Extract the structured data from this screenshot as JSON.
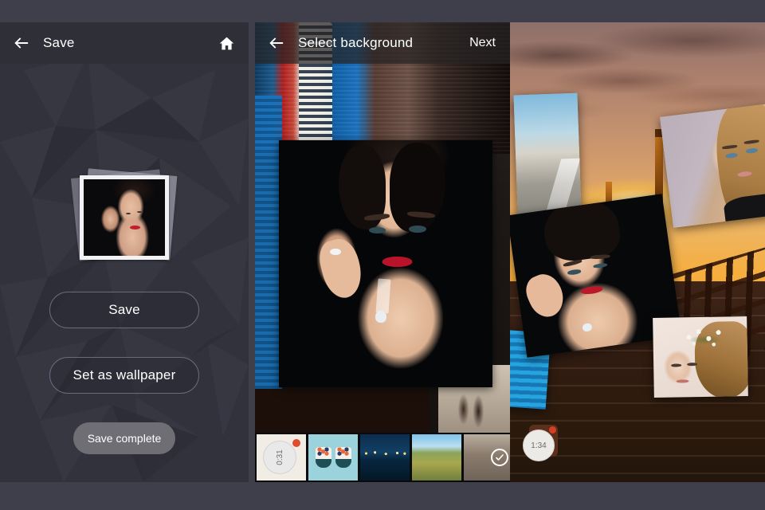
{
  "app": {
    "accent": "#e04a2f",
    "panel_bg": "#32323c",
    "page_bg": "#3f3f4c"
  },
  "panels": {
    "save": {
      "name": "Save screen",
      "appbar": {
        "back_icon": "arrow-left-icon",
        "title": "Save",
        "home_icon": "home-icon"
      },
      "preview": {
        "alt": "polaroid photo frame preview"
      },
      "buttons": {
        "save": "Save",
        "wallpaper": "Set as wallpaper"
      },
      "toast": "Save complete"
    },
    "select_background": {
      "name": "Select background screen",
      "appbar": {
        "back_icon": "arrow-left-icon",
        "title": "Select background",
        "action": "Next"
      },
      "thumbnails": [
        {
          "id": "thumb-timer",
          "label": "0:31",
          "selected": false,
          "badge": true
        },
        {
          "id": "thumb-shoes",
          "label": "",
          "selected": false,
          "badge": false
        },
        {
          "id": "thumb-night-city",
          "label": "",
          "selected": false,
          "badge": false
        },
        {
          "id": "thumb-field-road",
          "label": "",
          "selected": false,
          "badge": false
        },
        {
          "id": "thumb-selected",
          "label": "",
          "selected": true,
          "badge": false,
          "check_icon": "check-icon"
        }
      ]
    },
    "compose": {
      "name": "Composition preview",
      "timer_chip": {
        "label": "1:34",
        "badge": true
      },
      "cards": [
        {
          "id": "card-road",
          "alt": "road landscape photo card"
        },
        {
          "id": "card-blonde",
          "alt": "blonde woman portrait card"
        },
        {
          "id": "card-model",
          "alt": "model portrait card"
        },
        {
          "id": "card-bride",
          "alt": "bride with flower crown card"
        },
        {
          "id": "card-blue",
          "alt": "blue striped photo card"
        }
      ]
    }
  }
}
